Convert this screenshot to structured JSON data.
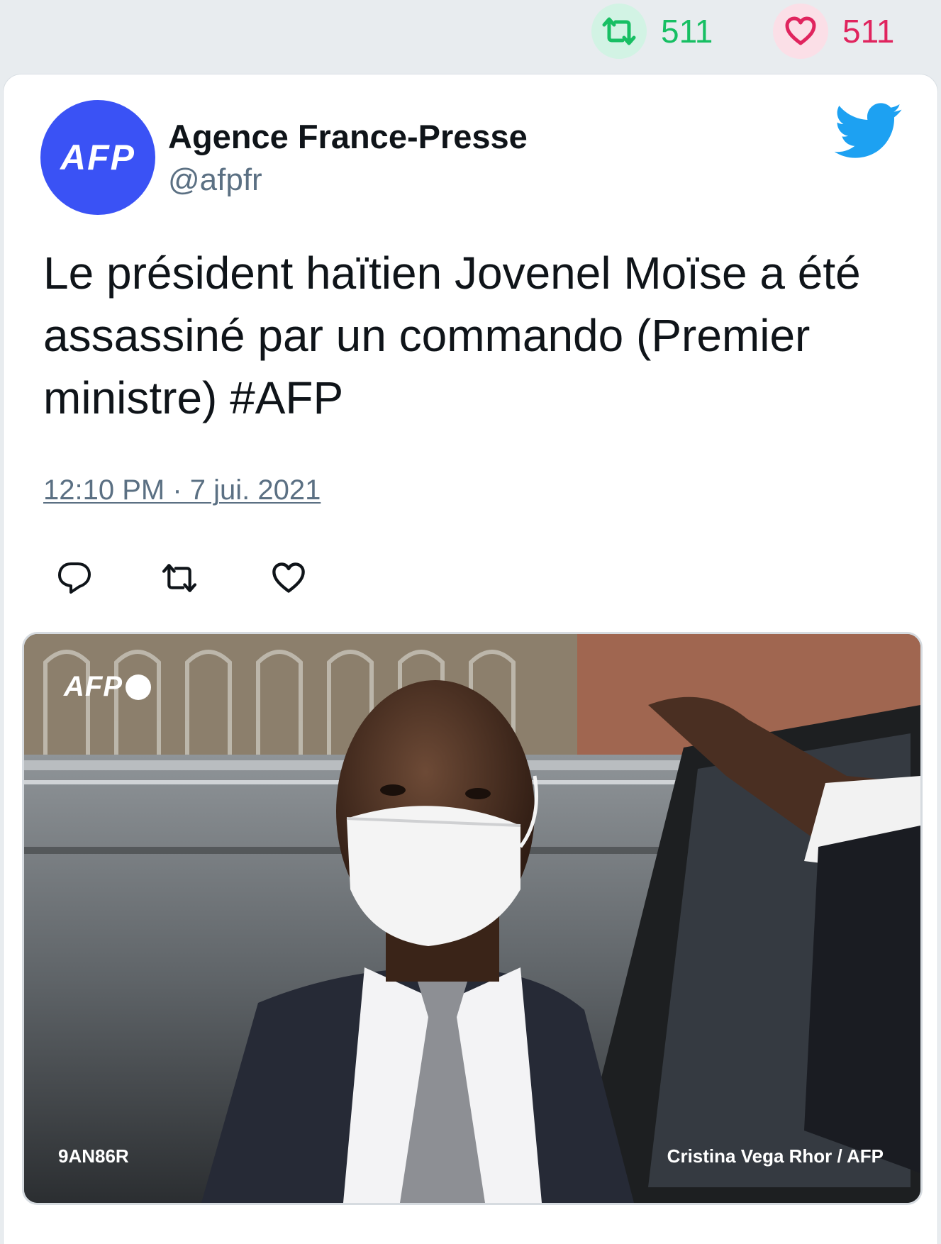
{
  "stats": {
    "retweets": {
      "icon": "retweet-icon",
      "count": "511",
      "color": "#17bf63"
    },
    "likes": {
      "icon": "heart-icon",
      "count": "511",
      "color": "#e0245e"
    }
  },
  "tweet": {
    "author": {
      "name": "Agence France-Presse",
      "handle": "@afpfr",
      "avatar_text": "AFP",
      "avatar_color": "#3a52f5"
    },
    "brand_icon": "twitter-bird-icon",
    "brand_color": "#1da1f2",
    "text": "Le président haïtien Jovenel Moïse a été assassiné par un commando (Premier ministre) #AFP",
    "timestamp": "12:10 PM · 7 jui. 2021",
    "actions": [
      "reply-icon",
      "retweet-icon",
      "like-icon"
    ],
    "photo": {
      "watermark": "AFP",
      "reference_code": "9AN86R",
      "credit": "Cristina Vega Rhor / AFP"
    }
  }
}
